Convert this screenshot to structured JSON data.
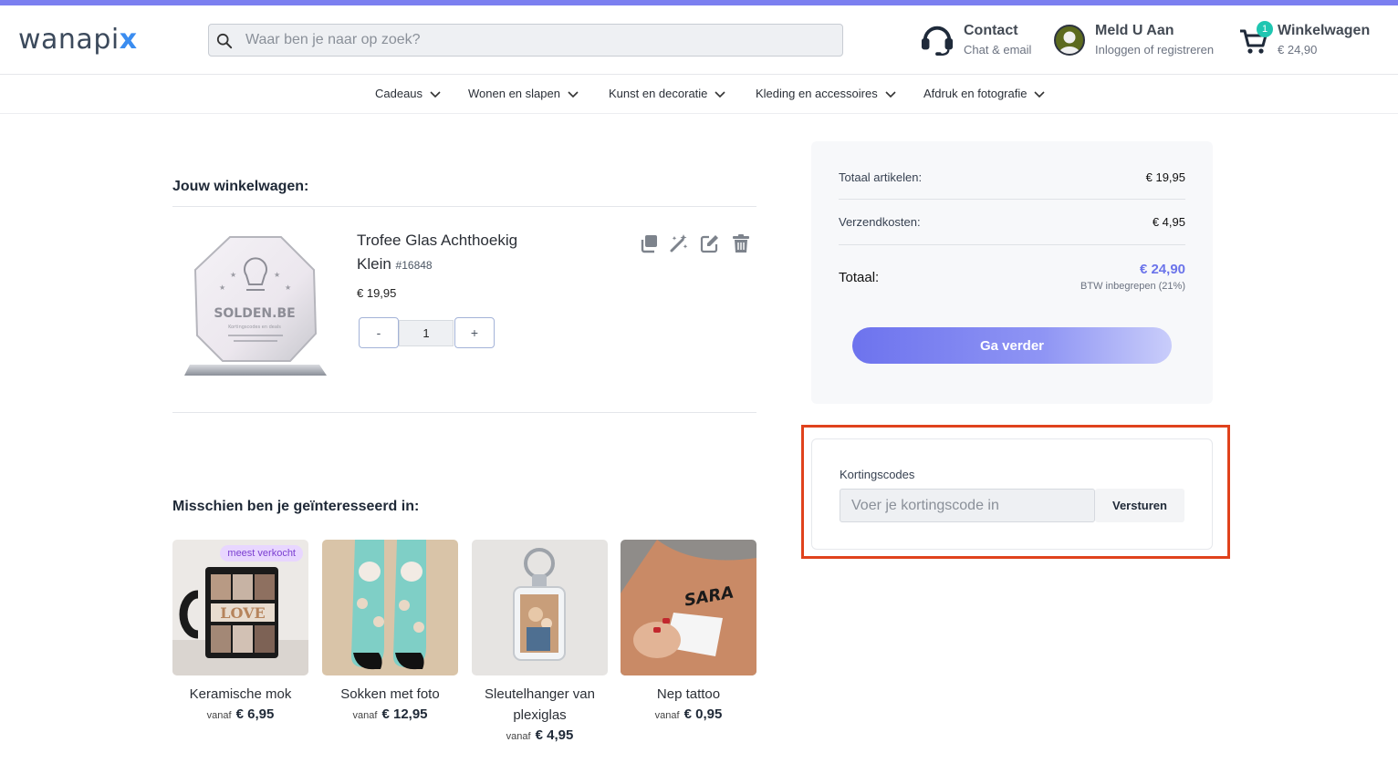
{
  "brand": {
    "logo_main": "wanapi",
    "logo_x": "x"
  },
  "search": {
    "placeholder": "Waar ben je naar op zoek?"
  },
  "header": {
    "contact": {
      "title": "Contact",
      "subtitle": "Chat & email"
    },
    "account": {
      "title": "Meld U Aan",
      "subtitle": "Inloggen of registreren"
    },
    "cart": {
      "title": "Winkelwagen",
      "amount": "€ 24,90",
      "badge": "1"
    }
  },
  "nav": {
    "items": [
      {
        "label": "Cadeaus"
      },
      {
        "label": "Wonen en slapen"
      },
      {
        "label": "Kunst en decoratie"
      },
      {
        "label": "Kleding en accessoires"
      },
      {
        "label": "Afdruk en fotografie"
      }
    ]
  },
  "cart": {
    "title": "Jouw winkelwagen:",
    "item": {
      "name_line1": "Trofee Glas Achthoekig",
      "name_line2": "Klein",
      "sku": "#16848",
      "price": "€ 19,95",
      "qty": "1",
      "minus": "-",
      "plus": "+",
      "img_text": "SOLDEN.BE",
      "img_subtext": "Kortingscodes en deals"
    }
  },
  "recommendations": {
    "title": "Misschien ben je geïnteresseerd in:",
    "prefix": "vanaf",
    "items": [
      {
        "name": "Keramische mok",
        "price": "€ 6,95",
        "tag": "meest verkocht",
        "img_text": "LOVE"
      },
      {
        "name": "Sokken met foto",
        "price": "€ 12,95"
      },
      {
        "name": "Sleutelhanger van plexiglas",
        "price": "€ 4,95"
      },
      {
        "name": "Nep tattoo",
        "price": "€ 0,95",
        "img_text": "SARA"
      }
    ]
  },
  "summary": {
    "items_label": "Totaal artikelen:",
    "items_value": "€ 19,95",
    "shipping_label": "Verzendkosten:",
    "shipping_value": "€ 4,95",
    "total_label": "Totaal:",
    "total_value": "€ 24,90",
    "vat_note": "BTW inbegrepen (21%)",
    "continue_label": "Ga verder"
  },
  "discount": {
    "label": "Kortingscodes",
    "placeholder": "Voer je kortingscode in",
    "submit_label": "Versturen"
  },
  "colors": {
    "accent": "#7b7ff0",
    "total": "#6b74ea",
    "badge": "#1fc6b1",
    "highlight": "#e0421c"
  }
}
